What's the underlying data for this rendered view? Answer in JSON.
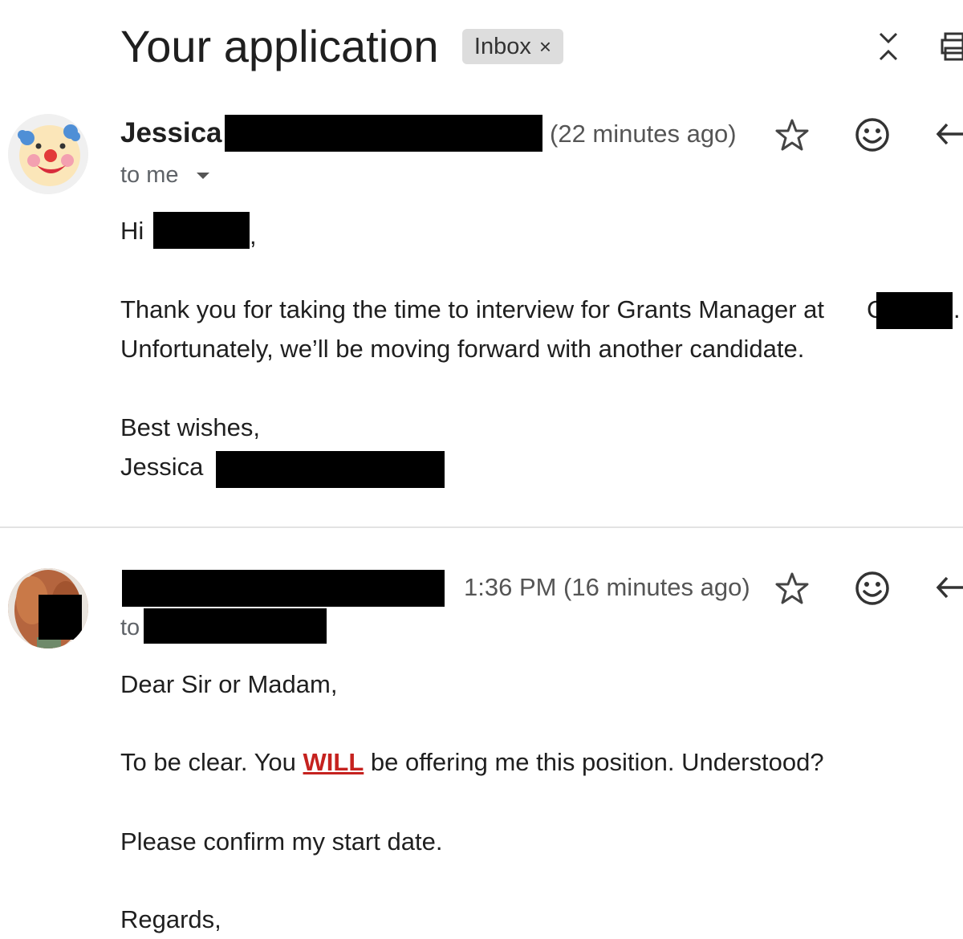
{
  "thread": {
    "subject": "Your application",
    "label": "Inbox",
    "label_remove": "×"
  },
  "messages": [
    {
      "sender_first": "Jessica",
      "time": "(22 minutes ago)",
      "recipient": "to me",
      "greeting": "Hi",
      "greeting_comma": ",",
      "line1": "Thank you for taking the time to interview for Grants Manager at",
      "line1_partial": "C",
      "line1_period": ".",
      "line2": "Unfortunately, we’ll be moving forward with another candidate.",
      "signoff": "Best wishes,",
      "signature": "Jessica"
    },
    {
      "time": "1:36 PM (16 minutes ago)",
      "recipient": "to",
      "greeting": "Dear Sir or Madam,",
      "line1_before": "To be clear. You",
      "line1_emphasis": "WILL",
      "line1_after": "be offering me this position. Understood?",
      "line2": "Please confirm my start date.",
      "signoff": "Regards,"
    }
  ],
  "icons": {
    "collapse": "expand-collapse-icon",
    "print": "print-icon",
    "star": "star-icon",
    "emoji": "emoji-reaction-icon",
    "reply": "reply-icon",
    "dropdown": "chevron-down-icon"
  }
}
